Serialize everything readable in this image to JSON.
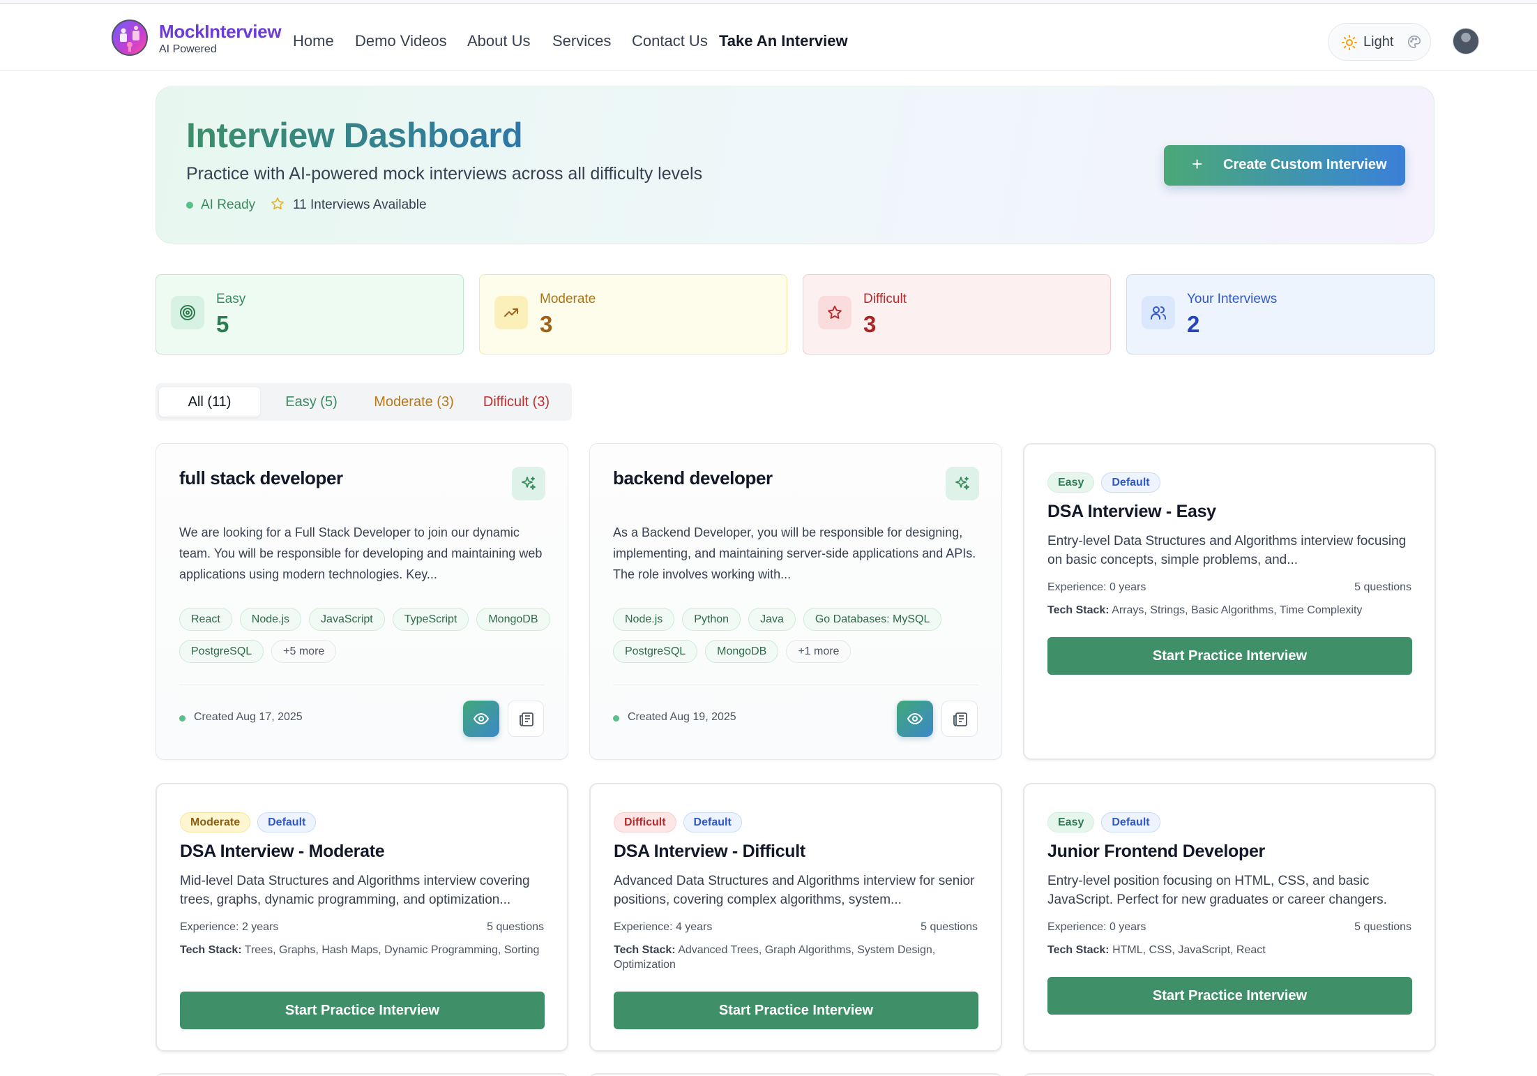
{
  "brand": {
    "name": "MockInterview",
    "subtitle": "AI Powered"
  },
  "nav": {
    "home": "Home",
    "demo_videos": "Demo Videos",
    "about": "About Us",
    "services": "Services",
    "contact": "Contact Us",
    "take_interview": "Take An Interview"
  },
  "theme": {
    "label": "Light"
  },
  "hero": {
    "title": "Interview Dashboard",
    "subtitle": "Practice with AI-powered mock interviews across all difficulty levels",
    "status": "AI Ready",
    "available": "11 Interviews Available",
    "create_button": "Create Custom Interview"
  },
  "stats": {
    "easy": {
      "label": "Easy",
      "value": "5"
    },
    "moderate": {
      "label": "Moderate",
      "value": "3"
    },
    "difficult": {
      "label": "Difficult",
      "value": "3"
    },
    "yours": {
      "label": "Your Interviews",
      "value": "2"
    }
  },
  "tabs": {
    "all": "All (11)",
    "easy": "Easy (5)",
    "moderate": "Moderate (3)",
    "difficult": "Difficult (3)"
  },
  "custom_interviews": [
    {
      "title": "full stack developer",
      "description": "We are looking for a Full Stack Developer to join our dynamic team. You will be responsible for developing and maintaining web applications using modern technologies. Key...",
      "tags": [
        "React",
        "Node.js",
        "JavaScript",
        "TypeScript",
        "MongoDB",
        "PostgreSQL"
      ],
      "more": "+5 more",
      "created": "Created Aug 17, 2025"
    },
    {
      "title": "backend developer",
      "description": "As a Backend Developer, you will be responsible for designing, implementing, and maintaining server-side applications and APIs. The role involves working with...",
      "tags": [
        "Node.js",
        "Python",
        "Java",
        "Go Databases: MySQL",
        "PostgreSQL",
        "MongoDB"
      ],
      "more": "+1 more",
      "created": "Created Aug 19, 2025"
    }
  ],
  "templates": [
    {
      "difficulty": "Easy",
      "tag": "Default",
      "title": "DSA Interview - Easy",
      "description": "Entry-level Data Structures and Algorithms interview focusing on basic concepts, simple problems, and...",
      "experience": "Experience: 0 years",
      "questions": "5 questions",
      "stack_label": "Tech Stack:",
      "stack": "Arrays, Strings, Basic Algorithms, Time Complexity",
      "button": "Start Practice Interview"
    },
    {
      "difficulty": "Moderate",
      "tag": "Default",
      "title": "DSA Interview - Moderate",
      "description": "Mid-level Data Structures and Algorithms interview covering trees, graphs, dynamic programming, and optimization...",
      "experience": "Experience: 2 years",
      "questions": "5 questions",
      "stack_label": "Tech Stack:",
      "stack": "Trees, Graphs, Hash Maps, Dynamic Programming, Sorting",
      "button": "Start Practice Interview"
    },
    {
      "difficulty": "Difficult",
      "tag": "Default",
      "title": "DSA Interview - Difficult",
      "description": "Advanced Data Structures and Algorithms interview for senior positions, covering complex algorithms, system...",
      "experience": "Experience: 4 years",
      "questions": "5 questions",
      "stack_label": "Tech Stack:",
      "stack": "Advanced Trees, Graph Algorithms, System Design, Optimization",
      "button": "Start Practice Interview"
    },
    {
      "difficulty": "Easy",
      "tag": "Default",
      "title": "Junior Frontend Developer",
      "description": "Entry-level position focusing on HTML, CSS, and basic JavaScript. Perfect for new graduates or career changers.",
      "experience": "Experience: 0 years",
      "questions": "5 questions",
      "stack_label": "Tech Stack:",
      "stack": "HTML, CSS, JavaScript, React",
      "button": "Start Practice Interview"
    }
  ],
  "colors": {
    "brand": "#6d3bd6",
    "primary_green": "#3f8f68",
    "easy": "#2e7a51",
    "moderate": "#a0621a",
    "difficult": "#a82525",
    "yours": "#2545b8"
  }
}
